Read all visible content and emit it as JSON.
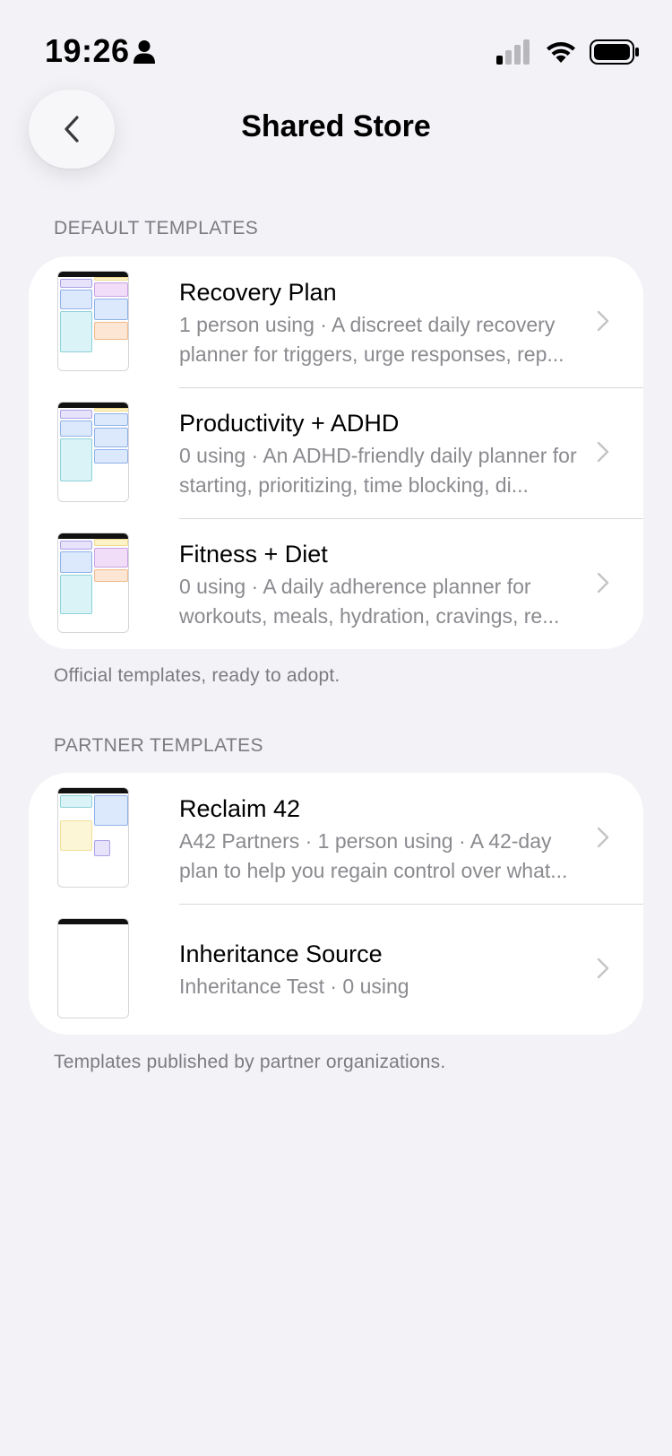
{
  "status_bar": {
    "time": "19:26"
  },
  "nav": {
    "title": "Shared Store"
  },
  "sections": [
    {
      "header": "DEFAULT TEMPLATES",
      "footer": "Official templates, ready to adopt.",
      "items": [
        {
          "title": "Recovery Plan",
          "subtitle": "1 person using · A discreet daily recovery planner for triggers, urge responses, rep..."
        },
        {
          "title": "Productivity + ADHD",
          "subtitle": "0 using · An ADHD-friendly daily planner for starting, prioritizing, time blocking, di..."
        },
        {
          "title": "Fitness + Diet",
          "subtitle": "0 using · A daily adherence planner for workouts, meals, hydration, cravings, re..."
        }
      ]
    },
    {
      "header": "PARTNER TEMPLATES",
      "footer": "Templates published by partner organizations.",
      "items": [
        {
          "title": "Reclaim 42",
          "subtitle": "A42 Partners · 1 person using · A 42-day plan to help you regain control over what..."
        },
        {
          "title": "Inheritance Source",
          "subtitle": "Inheritance Test · 0 using"
        }
      ]
    }
  ]
}
